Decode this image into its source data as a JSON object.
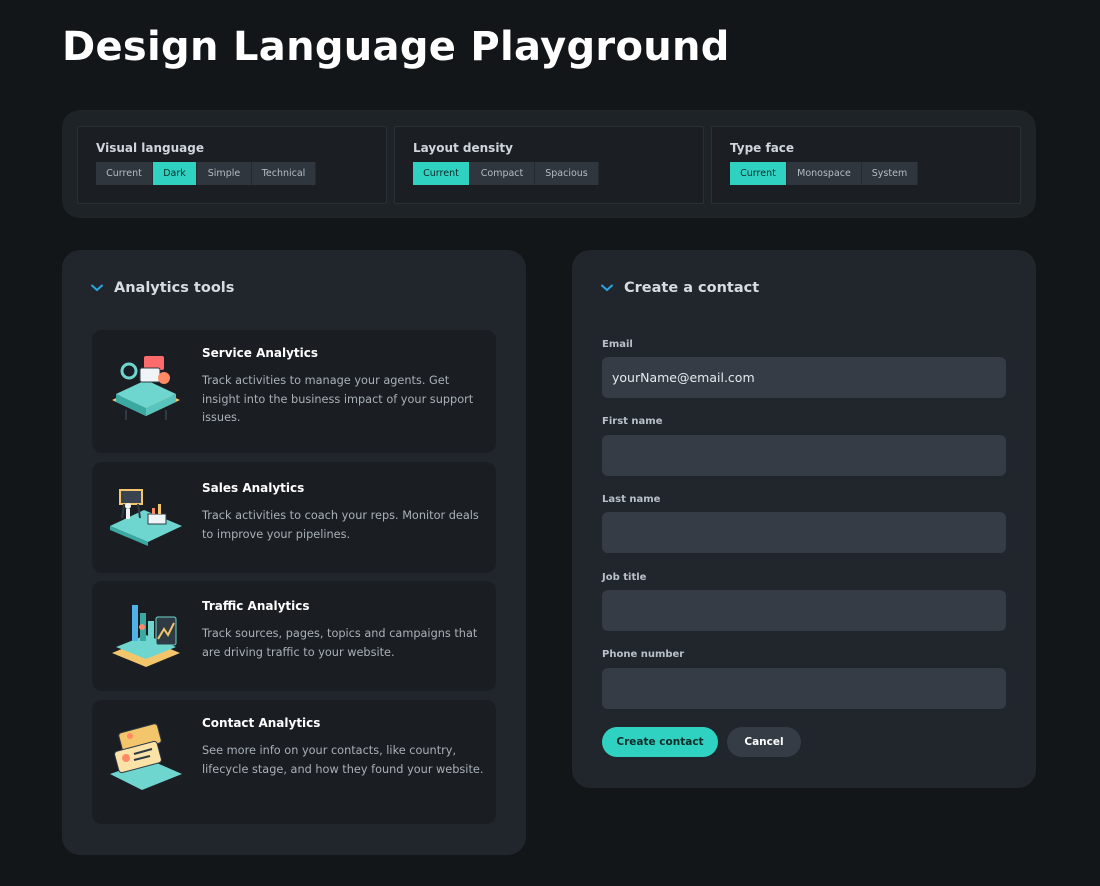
{
  "page": {
    "title": "Design Language Playground"
  },
  "settings": {
    "visual_language": {
      "label": "Visual language",
      "options": [
        "Current",
        "Dark",
        "Simple",
        "Technical"
      ],
      "selected": "Dark"
    },
    "layout_density": {
      "label": "Layout density",
      "options": [
        "Current",
        "Compact",
        "Spacious"
      ],
      "selected": "Current"
    },
    "type_face": {
      "label": "Type face",
      "options": [
        "Current",
        "Monospace",
        "System"
      ],
      "selected": "Current"
    }
  },
  "analytics": {
    "title": "Analytics tools",
    "tools": [
      {
        "title": "Service Analytics",
        "description": "Track activities to manage your agents. Get insight into the business impact of your support issues.",
        "illustration": "service-analytics-illustration"
      },
      {
        "title": "Sales Analytics",
        "description": "Track activities to coach your reps. Monitor deals to improve your pipelines.",
        "illustration": "sales-analytics-illustration"
      },
      {
        "title": "Traffic Analytics",
        "description": "Track sources, pages, topics and campaigns that are driving traffic to your website.",
        "illustration": "traffic-analytics-illustration"
      },
      {
        "title": "Contact Analytics",
        "description": "See more info on your contacts, like country, lifecycle stage, and how they found your website.",
        "illustration": "contact-analytics-illustration"
      }
    ]
  },
  "contact_form": {
    "title": "Create a contact",
    "fields": {
      "email": {
        "label": "Email",
        "value": "yourName@email.com"
      },
      "first_name": {
        "label": "First name",
        "value": ""
      },
      "last_name": {
        "label": "Last name",
        "value": ""
      },
      "job_title": {
        "label": "Job title",
        "value": ""
      },
      "phone": {
        "label": "Phone number",
        "value": ""
      }
    },
    "submit_label": "Create contact",
    "cancel_label": "Cancel"
  },
  "colors": {
    "accent": "#2fd1c0",
    "background": "#131618",
    "card": "#21262d",
    "chevron": "#2aa3e0"
  }
}
